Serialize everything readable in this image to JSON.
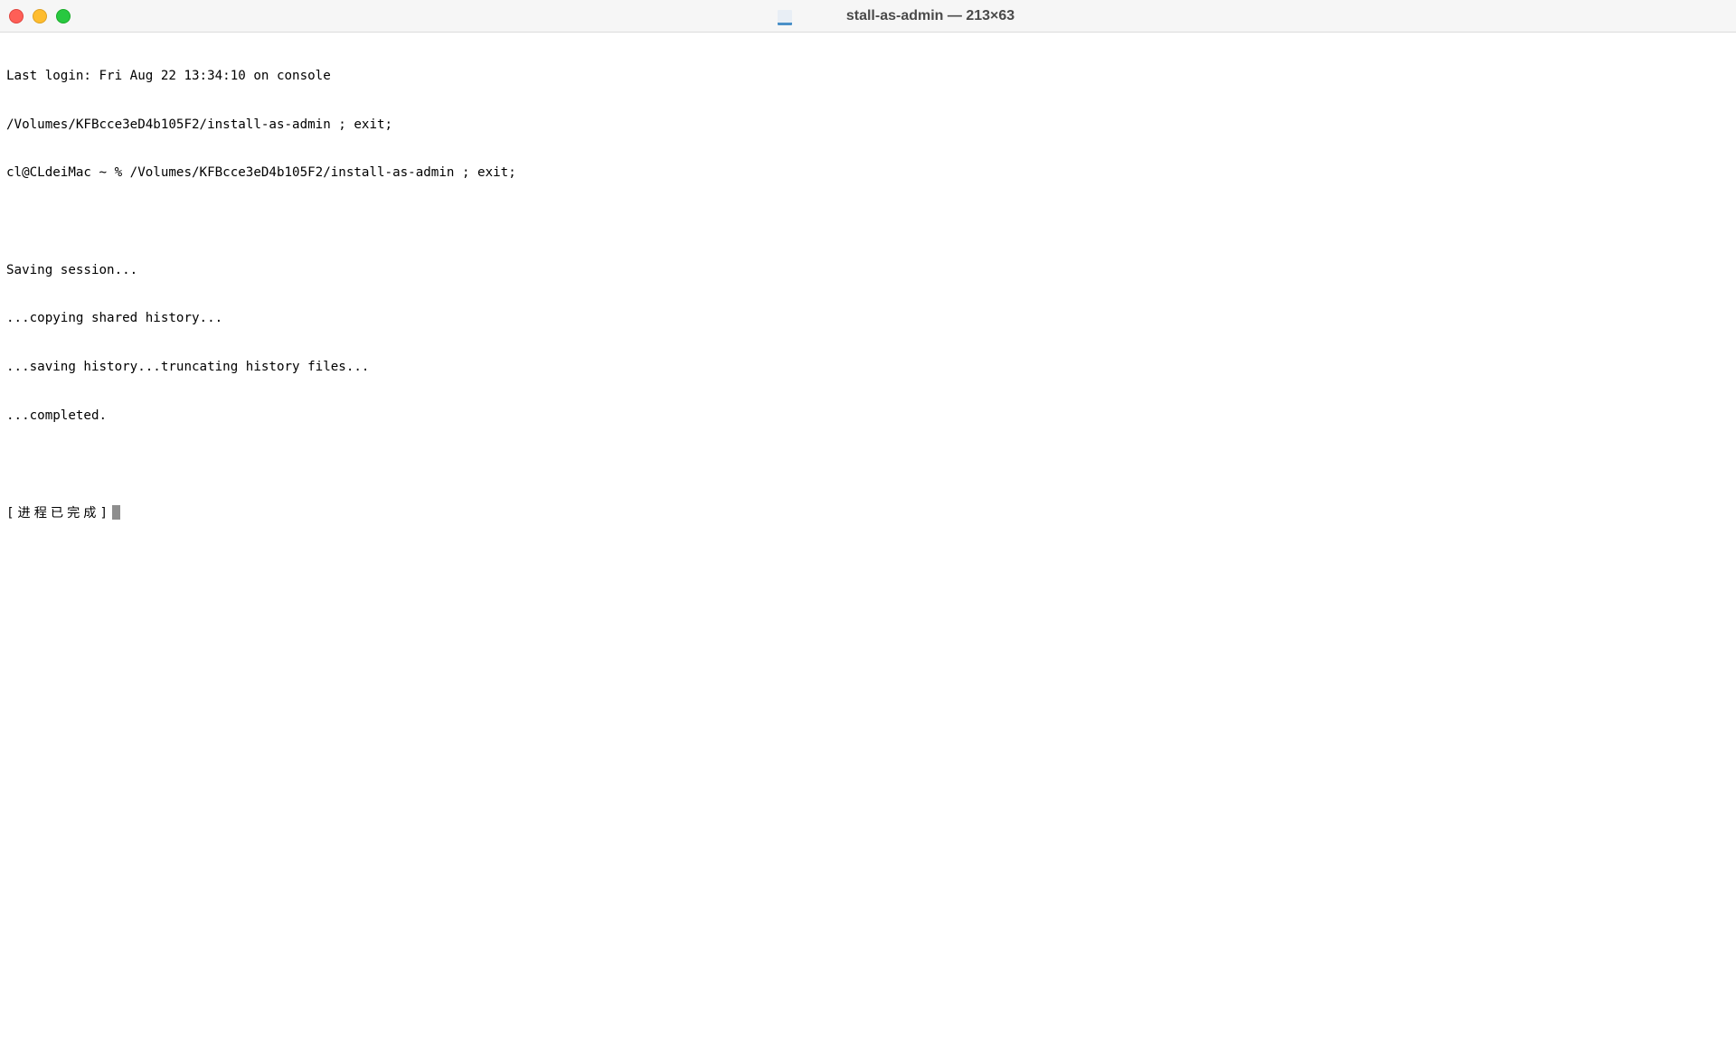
{
  "window": {
    "title": "stall-as-admin — 213×63",
    "title_icon": "terminal-document-icon"
  },
  "traffic_lights": {
    "close_color": "#fe5f57",
    "minimize_color": "#febc2e",
    "zoom_color": "#28c840"
  },
  "terminal": {
    "lines": [
      "Last login: Fri Aug 22 13:34:10 on console",
      "/Volumes/KFBcce3eD4b105F2/install-as-admin ; exit;",
      "cl@CLdeiMac ~ % /Volumes/KFBcce3eD4b105F2/install-as-admin ; exit;",
      "",
      "Saving session...",
      "...copying shared history...",
      "...saving history...truncating history files...",
      "...completed.",
      ""
    ],
    "final_line": "[进程已完成]",
    "cursor_color": "#8e8e8e"
  }
}
